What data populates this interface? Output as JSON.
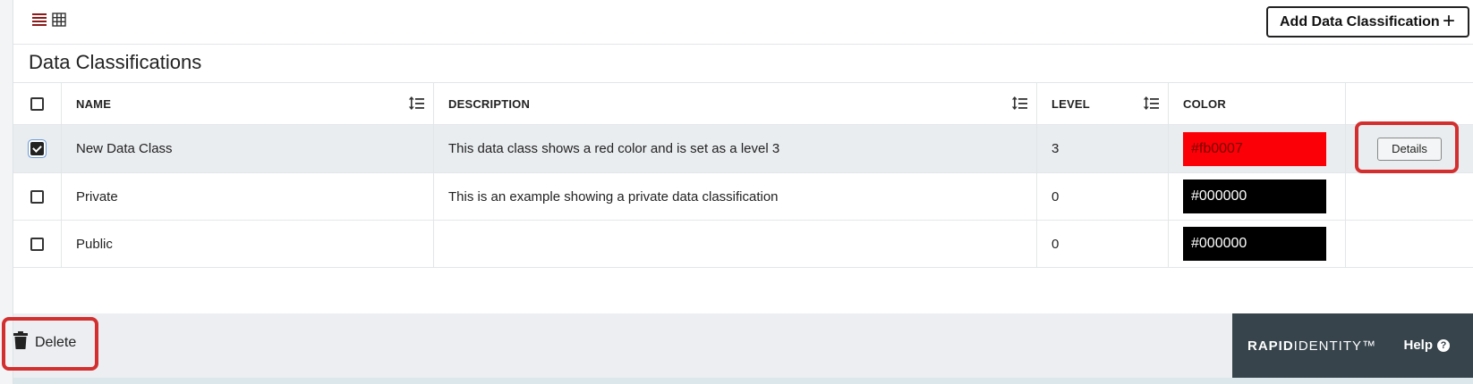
{
  "toolbar": {
    "add_label": "Add Data Classification",
    "add_icon": "plus-icon"
  },
  "page": {
    "title": "Data Classifications"
  },
  "table": {
    "columns": {
      "name": "NAME",
      "description": "DESCRIPTION",
      "level": "LEVEL",
      "color": "COLOR"
    },
    "rows": [
      {
        "checked": true,
        "name": "New Data Class",
        "description": "This data class shows a red color and is set as a level 3",
        "level": "3",
        "color": "#fb0007",
        "details_label": "Details"
      },
      {
        "checked": false,
        "name": "Private",
        "description": "This is an example showing a private data classification",
        "level": "0",
        "color": "#000000"
      },
      {
        "checked": false,
        "name": "Public",
        "description": "",
        "level": "0",
        "color": "#000000"
      }
    ]
  },
  "footer": {
    "delete_label": "Delete",
    "brand_bold": "RAPID",
    "brand_light": "IDENTITY™",
    "help_label": "Help"
  },
  "colors": {
    "highlight": "#d32f2f",
    "list_view_active": "#8b1a1a",
    "brand_bar": "#37444c"
  }
}
